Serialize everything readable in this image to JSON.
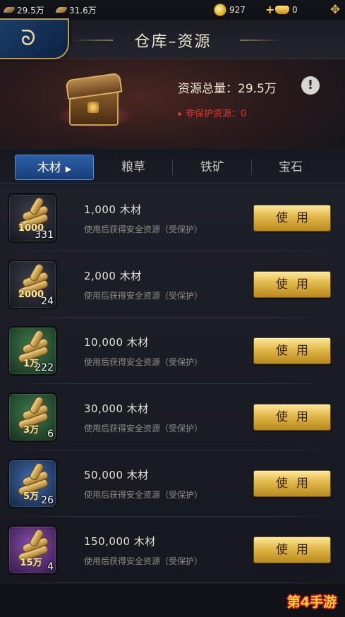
{
  "topbar": {
    "wood_value": "29.5万",
    "food_value": "31.6万",
    "coins": "927",
    "ingots": "0"
  },
  "header": {
    "title": "仓库–资源",
    "total_label": "资源总量：29.5万",
    "unprotected_label": "非保护资源：0"
  },
  "tabs": [
    {
      "label": "木材",
      "active": true
    },
    {
      "label": "粮草",
      "active": false
    },
    {
      "label": "铁矿",
      "active": false
    },
    {
      "label": "宝石",
      "active": false
    }
  ],
  "items": [
    {
      "amount_badge": "1000",
      "count": "331",
      "name": "1,000  木材",
      "desc": "使用后获得安全资源（受保护）",
      "button": "使用",
      "quality": "gray"
    },
    {
      "amount_badge": "2000",
      "count": "24",
      "name": "2,000  木材",
      "desc": "使用后获得安全资源（受保护）",
      "button": "使用",
      "quality": "gray"
    },
    {
      "amount_badge": "1万",
      "count": "222",
      "name": "10,000  木材",
      "desc": "使用后获得安全资源（受保护）",
      "button": "使用",
      "quality": "green"
    },
    {
      "amount_badge": "3万",
      "count": "6",
      "name": "30,000  木材",
      "desc": "使用后获得安全资源（受保护）",
      "button": "使用",
      "quality": "green"
    },
    {
      "amount_badge": "5万",
      "count": "26",
      "name": "50,000  木材",
      "desc": "使用后获得安全资源（受保护）",
      "button": "使用",
      "quality": "blue"
    },
    {
      "amount_badge": "15万",
      "count": "4",
      "name": "150,000  木材",
      "desc": "使用后获得安全资源（受保护）",
      "button": "使用",
      "quality": "purple"
    }
  ],
  "watermark": "第4手游",
  "colors": {
    "accent_gold": "#e1b84a",
    "tab_active": "#2b5fa8",
    "warning_red": "#e0362c"
  }
}
